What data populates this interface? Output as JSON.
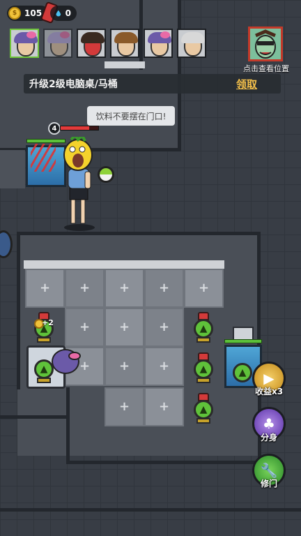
{
  "resources": {
    "coins": "105",
    "water": "0"
  },
  "boss": {
    "label": "点击查看位置",
    "icon": "villain-portrait-icon"
  },
  "quest": {
    "text": "升级2级电脑桌/马桶",
    "claim": "领取"
  },
  "speech": "饮料不要摆在门口!",
  "player": {
    "level": "4",
    "hp_fraction": 0.75
  },
  "upgrade_badge": "+2",
  "side_buttons": [
    {
      "label": "收益x3",
      "icon": "video-coin-icon",
      "color": "#e0a630"
    },
    {
      "label": "分身",
      "icon": "clone-icon",
      "color": "#7a4fc9"
    },
    {
      "label": "修门",
      "icon": "wrench-icon",
      "color": "#3aa23a"
    }
  ],
  "portraits": [
    {
      "name": "girl-bow",
      "hair": "#6b5aa8",
      "bow": true,
      "selected": true
    },
    {
      "name": "girl-bow-faded",
      "hair": "#b8a8e0",
      "bow": true,
      "selected": false
    },
    {
      "name": "red-hand-character",
      "hair": "#3a2a20",
      "bow": false,
      "selected": false
    },
    {
      "name": "brown-hair-girl",
      "hair": "#8a5a2a",
      "bow": false,
      "selected": false
    },
    {
      "name": "girl-bow-2",
      "hair": "#6b5aa8",
      "bow": true,
      "selected": false
    },
    {
      "name": "old-man",
      "hair": "#d8d8d8",
      "bow": false,
      "selected": false
    }
  ]
}
